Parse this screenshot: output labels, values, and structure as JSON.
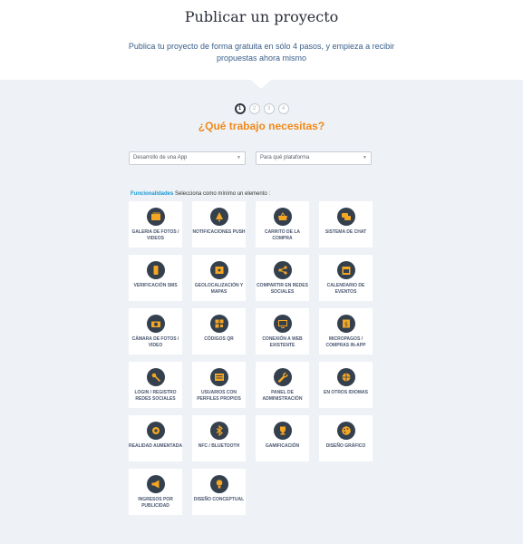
{
  "header": {
    "title": "Publicar un proyecto",
    "subtitle": "Publica tu proyecto de forma gratuita en sólo 4 pasos, y empieza a recibir propuestas ahora mismo"
  },
  "steps": [
    "1",
    "2",
    "3",
    "4"
  ],
  "active_step": 1,
  "question": "¿Qué trabajo necesitas?",
  "selects": {
    "type": {
      "value": "Desarrollo de una App"
    },
    "platform": {
      "value": "Para qué plataforma"
    }
  },
  "features": {
    "label_highlight": "Funcionalidades",
    "label_rest": " Selecciona como mínimo un elemento :",
    "items": [
      {
        "label": "GALERIA DE FOTOS / VIDEOS",
        "icon": "photo-gallery-icon"
      },
      {
        "label": "NOTIFICACIONES PUSH",
        "icon": "notification-icon"
      },
      {
        "label": "CARRITO DE LA COMPRA",
        "icon": "shopping-basket-icon"
      },
      {
        "label": "SISTEMA DE CHAT",
        "icon": "chat-icon"
      },
      {
        "label": "VERIFICACIÓN SMS",
        "icon": "phone-icon"
      },
      {
        "label": "GEOLOCALIZACIÓN Y MAPAS",
        "icon": "map-icon"
      },
      {
        "label": "COMPARTIR EN REDES SOCIALES",
        "icon": "share-icon"
      },
      {
        "label": "CALENDARIO DE EVENTOS",
        "icon": "calendar-icon"
      },
      {
        "label": "CÁMARA DE FOTOS / VIDEO",
        "icon": "camera-icon"
      },
      {
        "label": "CÓDIGOS QR",
        "icon": "qr-code-icon"
      },
      {
        "label": "CONEXIÓN A WEB EXISTENTE",
        "icon": "web-connection-icon"
      },
      {
        "label": "MICROPAGOS / COMPRAS IN-APP",
        "icon": "payment-icon"
      },
      {
        "label": "LOGIN / REGISTRO REDES SOCIALES",
        "icon": "key-icon"
      },
      {
        "label": "USUARIOS CON PERFILES PROPIOS",
        "icon": "user-profile-icon"
      },
      {
        "label": "PANEL DE ADMINISTRACIÓN",
        "icon": "wrench-icon"
      },
      {
        "label": "EN OTROS IDIOMAS",
        "icon": "globe-icon"
      },
      {
        "label": "REALIDAD AUMENTADA",
        "icon": "augmented-reality-icon"
      },
      {
        "label": "NFC / BLUETOOTH",
        "icon": "bluetooth-icon"
      },
      {
        "label": "GAMIFICACIÓN",
        "icon": "trophy-icon"
      },
      {
        "label": "DISEÑO GRÁFICO",
        "icon": "palette-icon"
      },
      {
        "label": "INGRESOS POR PUBLICIDAD",
        "icon": "advertising-icon"
      },
      {
        "label": "DISEÑO CONCEPTUAL",
        "icon": "lightbulb-icon"
      }
    ]
  },
  "colors": {
    "accent": "#f08a1c",
    "icon_circle": "#34404e",
    "icon_glyph": "#f5a623",
    "highlight": "#1a9bd6",
    "background": "#eef1f5"
  }
}
